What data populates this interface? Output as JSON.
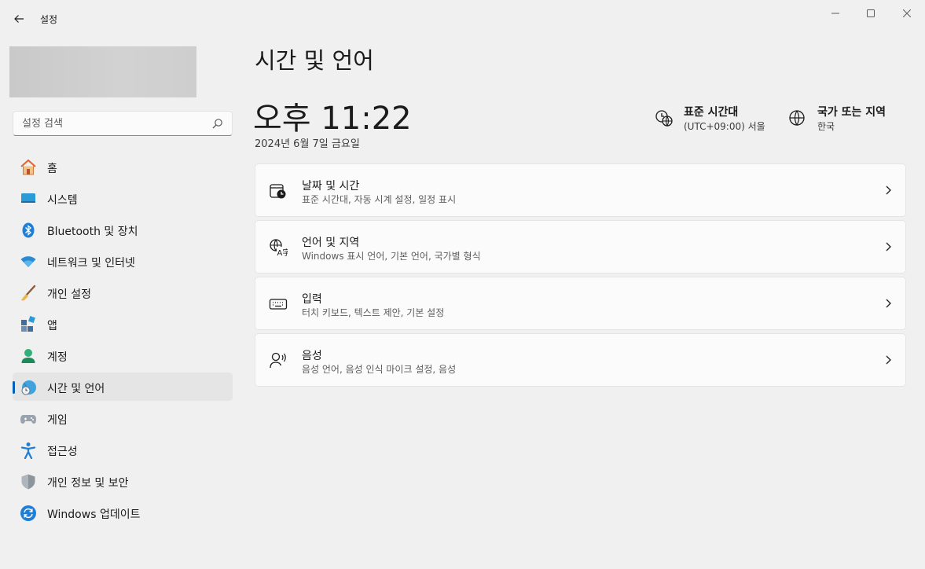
{
  "window": {
    "app_title": "설정"
  },
  "search": {
    "placeholder": "설정 검색"
  },
  "sidebar": {
    "items": [
      {
        "label": "홈",
        "icon": "home-icon"
      },
      {
        "label": "시스템",
        "icon": "system-icon"
      },
      {
        "label": "Bluetooth 및 장치",
        "icon": "bluetooth-icon"
      },
      {
        "label": "네트워크 및 인터넷",
        "icon": "wifi-icon"
      },
      {
        "label": "개인 설정",
        "icon": "brush-icon"
      },
      {
        "label": "앱",
        "icon": "apps-icon"
      },
      {
        "label": "계정",
        "icon": "account-icon"
      },
      {
        "label": "시간 및 언어",
        "icon": "time-language-icon",
        "active": true
      },
      {
        "label": "게임",
        "icon": "gamepad-icon"
      },
      {
        "label": "접근성",
        "icon": "accessibility-icon"
      },
      {
        "label": "개인 정보 및 보안",
        "icon": "shield-icon"
      },
      {
        "label": "Windows 업데이트",
        "icon": "update-icon"
      }
    ]
  },
  "main": {
    "page_title": "시간 및 언어",
    "time": "오후 11:22",
    "date": "2024년 6월 7일 금요일",
    "timezone": {
      "title": "표준 시간대",
      "value": "(UTC+09:00) 서울"
    },
    "region": {
      "title": "국가 또는 지역",
      "value": "한국"
    },
    "cards": [
      {
        "title": "날짜 및 시간",
        "subtitle": "표준 시간대, 자동 시계 설정, 일정 표시",
        "icon": "calendar-clock-icon"
      },
      {
        "title": "언어 및 지역",
        "subtitle": "Windows 표시 언어, 기본 언어, 국가별 형식",
        "icon": "language-icon"
      },
      {
        "title": "입력",
        "subtitle": "터치 키보드, 텍스트 제안, 기본 설정",
        "icon": "keyboard-icon"
      },
      {
        "title": "음성",
        "subtitle": "음성 언어, 음성 인식 마이크 설정, 음성",
        "icon": "speech-icon"
      }
    ]
  },
  "colors": {
    "accent": "#005fb8",
    "background": "#f0f0f0",
    "card": "#fbfbfb"
  }
}
